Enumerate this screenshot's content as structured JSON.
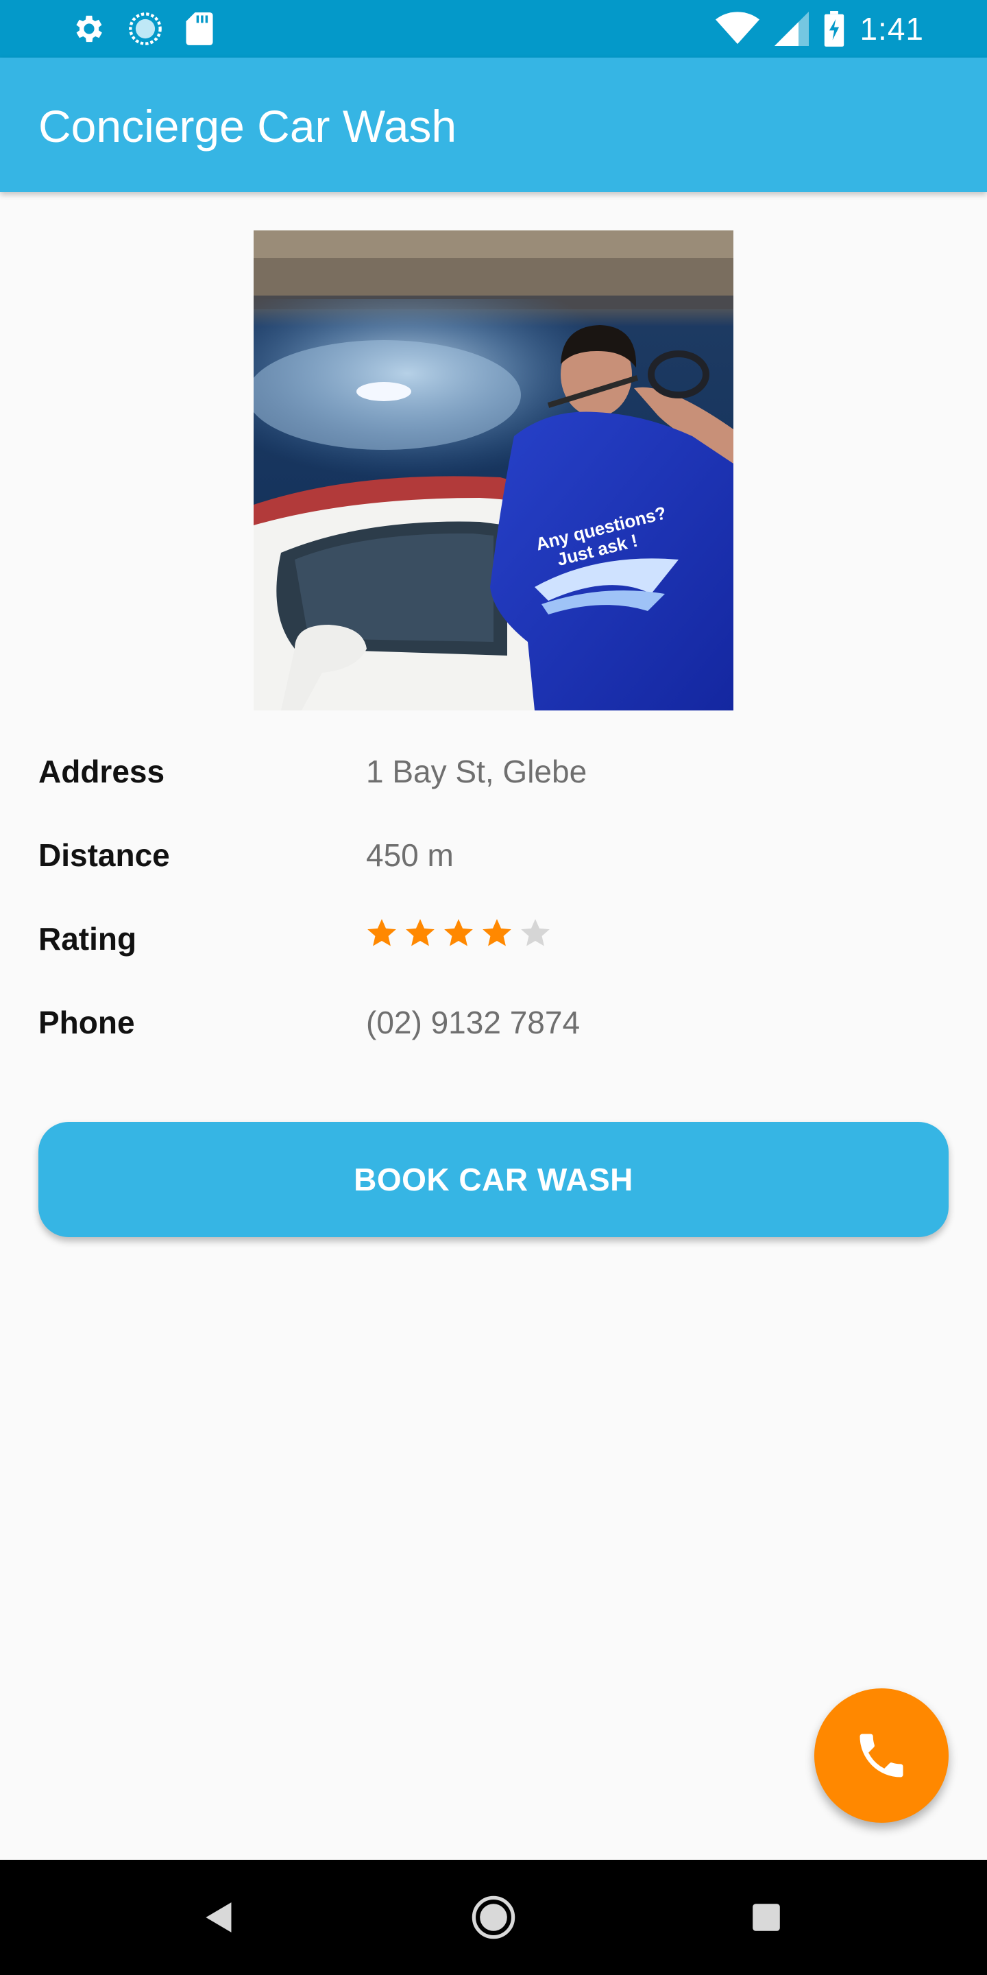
{
  "status_bar": {
    "time": "1:41",
    "icons": [
      "settings-icon",
      "sync-icon",
      "sd-card-icon",
      "wifi-icon",
      "signal-icon",
      "battery-charging-icon"
    ]
  },
  "app_bar": {
    "title": "Concierge Car Wash",
    "color": "#36b5e4"
  },
  "hero_image": {
    "shirt_text_line1": "Any questions?",
    "shirt_text_line2": "Just ask !"
  },
  "details": {
    "address_label": "Address",
    "address_value": "1 Bay St, Glebe",
    "distance_label": "Distance",
    "distance_value": "450 m",
    "rating_label": "Rating",
    "rating_value": 4,
    "rating_max": 5,
    "phone_label": "Phone",
    "phone_value": "(02) 9132 7874"
  },
  "book_button": {
    "label": "BOOK CAR WASH"
  },
  "fab": {
    "icon": "phone-icon",
    "color": "#ff8800"
  },
  "nav_bar": {
    "icons": [
      "back-icon",
      "home-icon",
      "recents-icon"
    ]
  }
}
